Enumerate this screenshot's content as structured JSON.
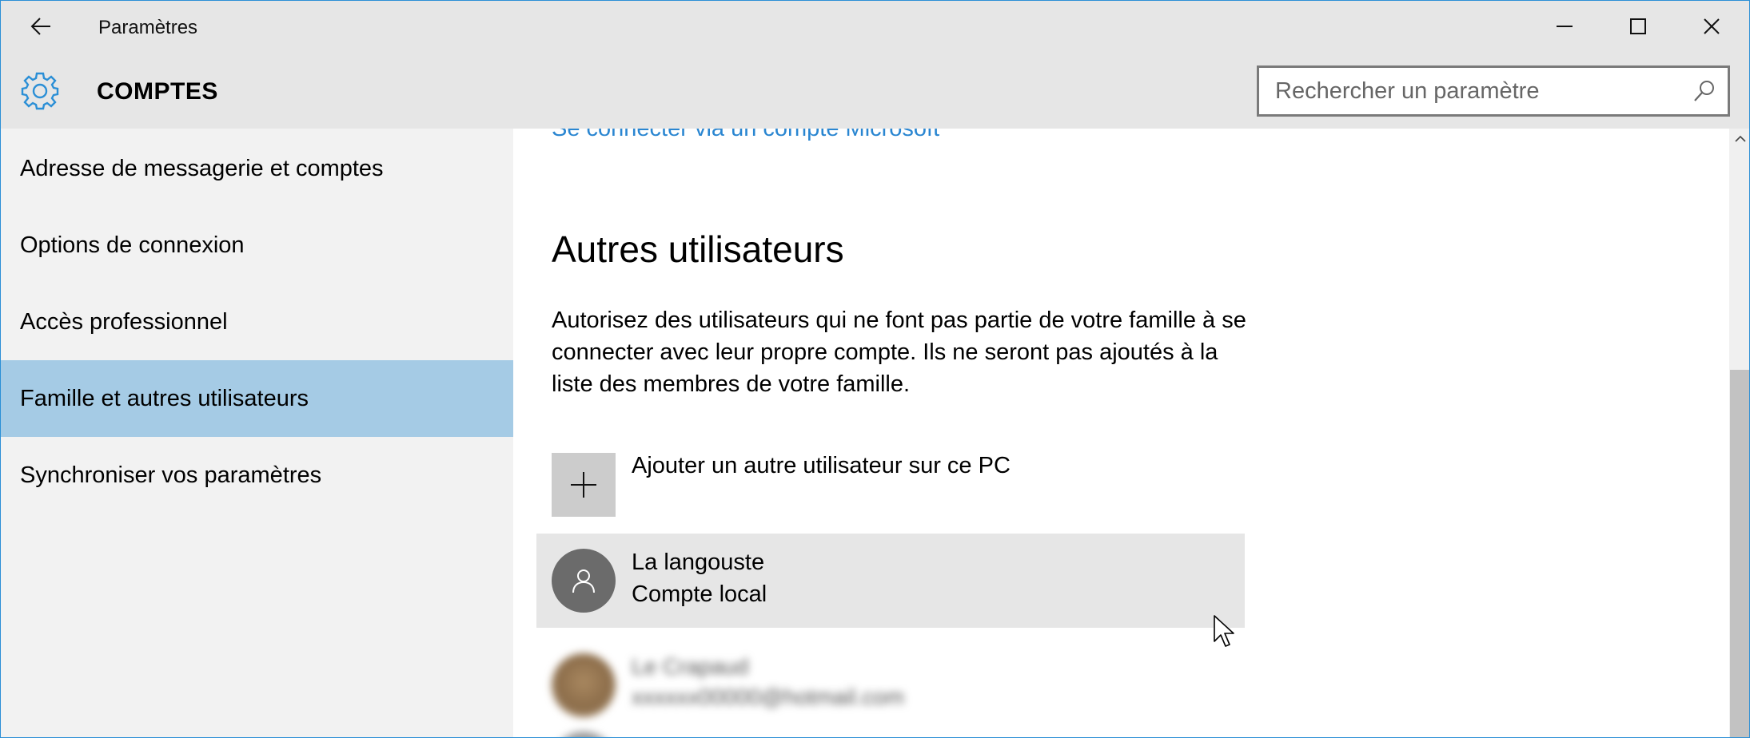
{
  "window": {
    "title": "Paramètres",
    "accent_color": "#2b8fd6"
  },
  "titlebar": {
    "back_icon": "back-arrow-icon",
    "minimize_icon": "minimize-icon",
    "maximize_icon": "maximize-icon",
    "close_icon": "close-icon"
  },
  "header": {
    "icon": "gear-icon",
    "title": "COMPTES",
    "search": {
      "placeholder": "Rechercher un paramètre",
      "icon": "search-icon"
    }
  },
  "sidebar": {
    "selected_color": "#a5cbe5",
    "items": [
      {
        "label": "Adresse de messagerie et comptes",
        "selected": false
      },
      {
        "label": "Options de connexion",
        "selected": false
      },
      {
        "label": "Accès professionnel",
        "selected": false
      },
      {
        "label": "Famille et autres utilisateurs",
        "selected": true
      },
      {
        "label": "Synchroniser vos paramètres",
        "selected": false
      }
    ]
  },
  "main": {
    "microsoft_link": "Se connecter via un compte Microsoft",
    "link_color": "#2a86d1",
    "other_users": {
      "heading": "Autres utilisateurs",
      "description": "Autorisez des utilisateurs qui ne font pas partie de votre famille à se connecter avec leur propre compte. Ils ne seront pas ajoutés à la liste des membres de votre famille.",
      "add_user": {
        "label": "Ajouter un autre utilisateur sur ce PC",
        "icon": "plus-icon"
      },
      "users": [
        {
          "name": "La langouste",
          "type": "Compte local",
          "icon": "user-icon"
        }
      ],
      "blurred_user": {
        "name": "Le Crapaud",
        "email": "xxxxxx00000@hotmail.com"
      }
    }
  },
  "scrollbar": {
    "up_icon": "chevron-up-icon"
  }
}
